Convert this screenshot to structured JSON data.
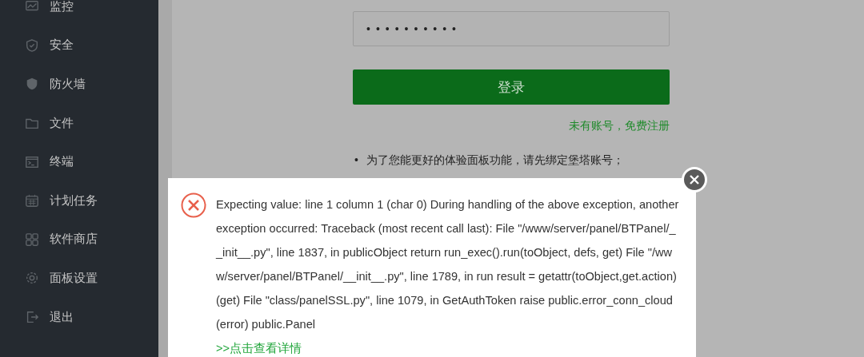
{
  "sidebar": {
    "items": [
      {
        "label": "监控",
        "kind": "monitor"
      },
      {
        "label": "安全",
        "kind": "shield"
      },
      {
        "label": "防火墙",
        "kind": "wall"
      },
      {
        "label": "文件",
        "kind": "folder"
      },
      {
        "label": "终端",
        "kind": "terminal"
      },
      {
        "label": "计划任务",
        "kind": "calendar"
      },
      {
        "label": "软件商店",
        "kind": "grid"
      },
      {
        "label": "面板设置",
        "kind": "gear"
      },
      {
        "label": "退出",
        "kind": "exit"
      }
    ]
  },
  "login": {
    "password": {
      "value": "••••••••••"
    },
    "button": "登录",
    "register_link": "未有账号，免费注册",
    "notes": [
      {
        "marker": "•",
        "text": "为了您能更好的体验面板功能，请先绑定堡塔账号；"
      }
    ]
  },
  "dialog": {
    "message": "Expecting value: line 1 column 1 (char 0) During handling of the above exception, another exception occurred: Traceback (most recent call last): File \"/www/server/panel/BTPanel/__init__.py\", line 1837, in publicObject return run_exec().run(toObject, defs, get) File \"/www/server/panel/BTPanel/__init__.py\", line 1789, in run result = getattr(toObject,get.action)(get) File \"class/panelSSL.py\", line 1079, in GetAuthToken raise public.error_conn_cloud(error) public.Panel",
    "details_link": ">>点击查看详情"
  }
}
